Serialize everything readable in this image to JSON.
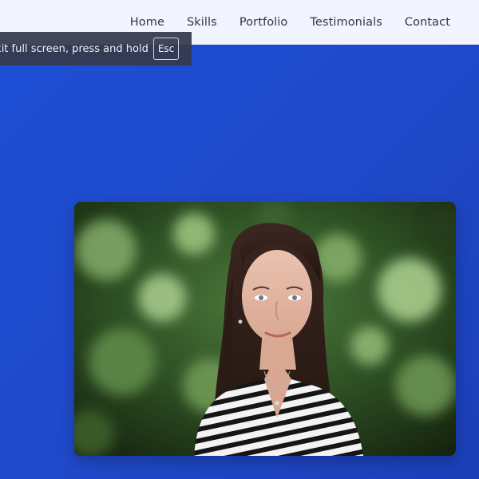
{
  "nav": {
    "items": [
      {
        "label": "Home"
      },
      {
        "label": "Skills"
      },
      {
        "label": "Portfolio"
      },
      {
        "label": "Testimonials"
      },
      {
        "label": "Contact"
      }
    ]
  },
  "fullscreen_toast": {
    "message": "xit full screen, press and hold",
    "key": "Esc"
  },
  "colors": {
    "hero_background": "#1f49c9",
    "navbar_background": "#f2f5fd",
    "nav_text": "#2f3645",
    "toast_background": "#363c4c"
  },
  "hero": {
    "photo_icon": "portrait-photo"
  }
}
